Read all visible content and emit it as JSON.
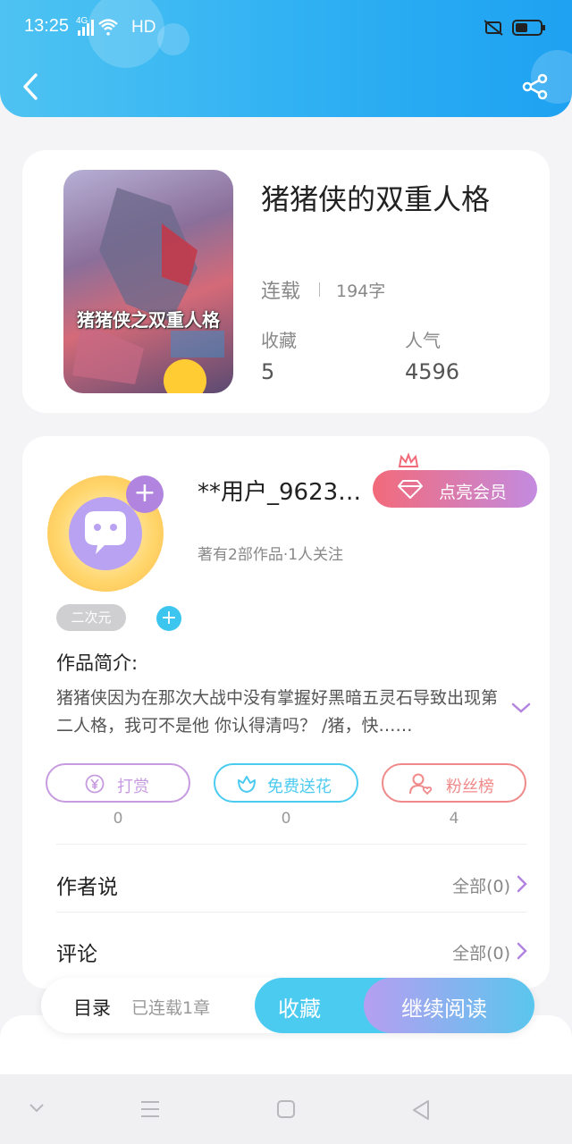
{
  "status_bar": {
    "time": "13:25",
    "network": "4G",
    "hd": "HD"
  },
  "book": {
    "title": "猪猪侠的双重人格",
    "status": "连载",
    "word_count": "194字",
    "cover_text": "猪猪侠之双重人格",
    "stats": [
      {
        "label": "收藏",
        "value": "5"
      },
      {
        "label": "人气",
        "value": "4596"
      }
    ]
  },
  "author": {
    "name": "**用户_96236...",
    "vip_label": "点亮会员",
    "meta": "著有2部作品·1人关注",
    "tag": "二次元"
  },
  "intro": {
    "label": "作品简介:",
    "text": "猪猪侠因为在那次大战中没有掌握好黑暗五灵石导致出现第二人格，我可不是他 你认得清吗？ /猪，快……"
  },
  "actions": [
    {
      "label": "打赏",
      "count": "0",
      "color": "#c79be0"
    },
    {
      "label": "免费送花",
      "count": "0",
      "color": "#4ccbf0"
    },
    {
      "label": "粉丝榜",
      "count": "4",
      "color": "#f08a8a"
    }
  ],
  "rows": [
    {
      "label": "作者说",
      "right": "全部(0)"
    },
    {
      "label": "评论",
      "right": "全部(0)"
    }
  ],
  "bottom": {
    "toc_label": "目录",
    "toc_sub": "已连载1章",
    "collect": "收藏",
    "read": "继续阅读"
  },
  "colors": {
    "header": "#2fb0f3",
    "accent": "#4ccbf0",
    "purple": "#b184e0"
  }
}
